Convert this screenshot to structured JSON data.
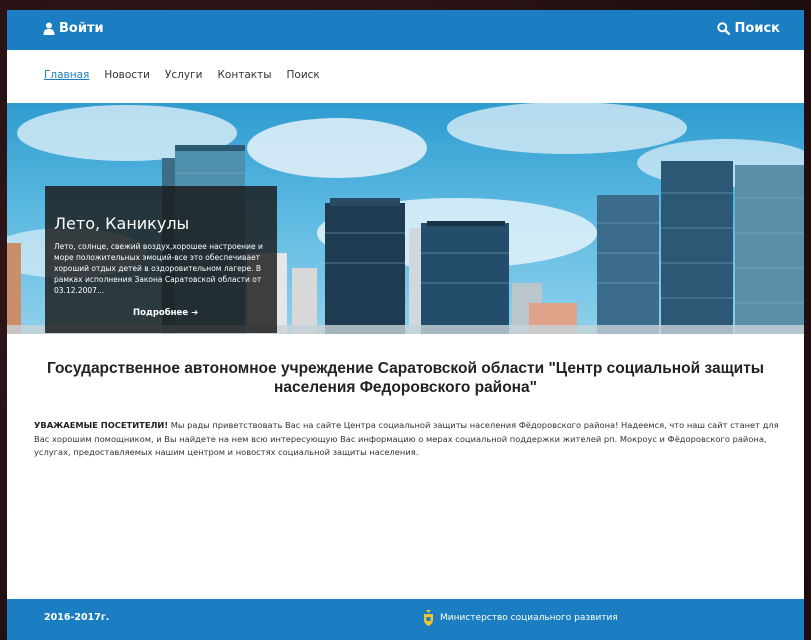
{
  "header": {
    "login_label": "Войти",
    "search_label": "Поиск"
  },
  "nav": {
    "items": [
      "Главная",
      "Новости",
      "Услуги",
      "Контакты",
      "Поиск"
    ]
  },
  "slide": {
    "title": "Лето, Каникулы",
    "text": "Лето, солнце, свежий воздух,хорошее настроение и море положительных эмоций-все это обеспечивает хороший отдых детей в оздоровительном лагере. В рамках исполнения Закона Саратовской области от 03.12.2007...",
    "more_label": "Подробнее"
  },
  "main": {
    "title": "Государственное автономное учреждение Саратовской области \"Центр социальной защиты населения Федоровского района\"",
    "intro_bold": "УВАЖАЕМЫЕ ПОСЕТИТЕЛИ!",
    "intro_text": " Мы рады приветствовать Вас на сайте Центра социальной защиты населения Фёдоровского района! Надеемся, что наш сайт станет для Вас хорошим помощником, и Вы найдете на нем всю интересующую Вас информацию о мерах социальной поддержки жителей рп. Мокроус и Фёдоровского района, услугах, предоставляемых нашим центром и новостях социальной защиты населения."
  },
  "footer": {
    "year": "2016-2017г.",
    "ministry_label": "Министерство социального развития"
  },
  "colors": {
    "brand": "#1b7ec2",
    "overlay": "#191919"
  },
  "icons": {
    "login": "user-icon",
    "search": "search-icon",
    "more": "arrow-right-icon",
    "ministry": "coat-of-arms-icon"
  }
}
